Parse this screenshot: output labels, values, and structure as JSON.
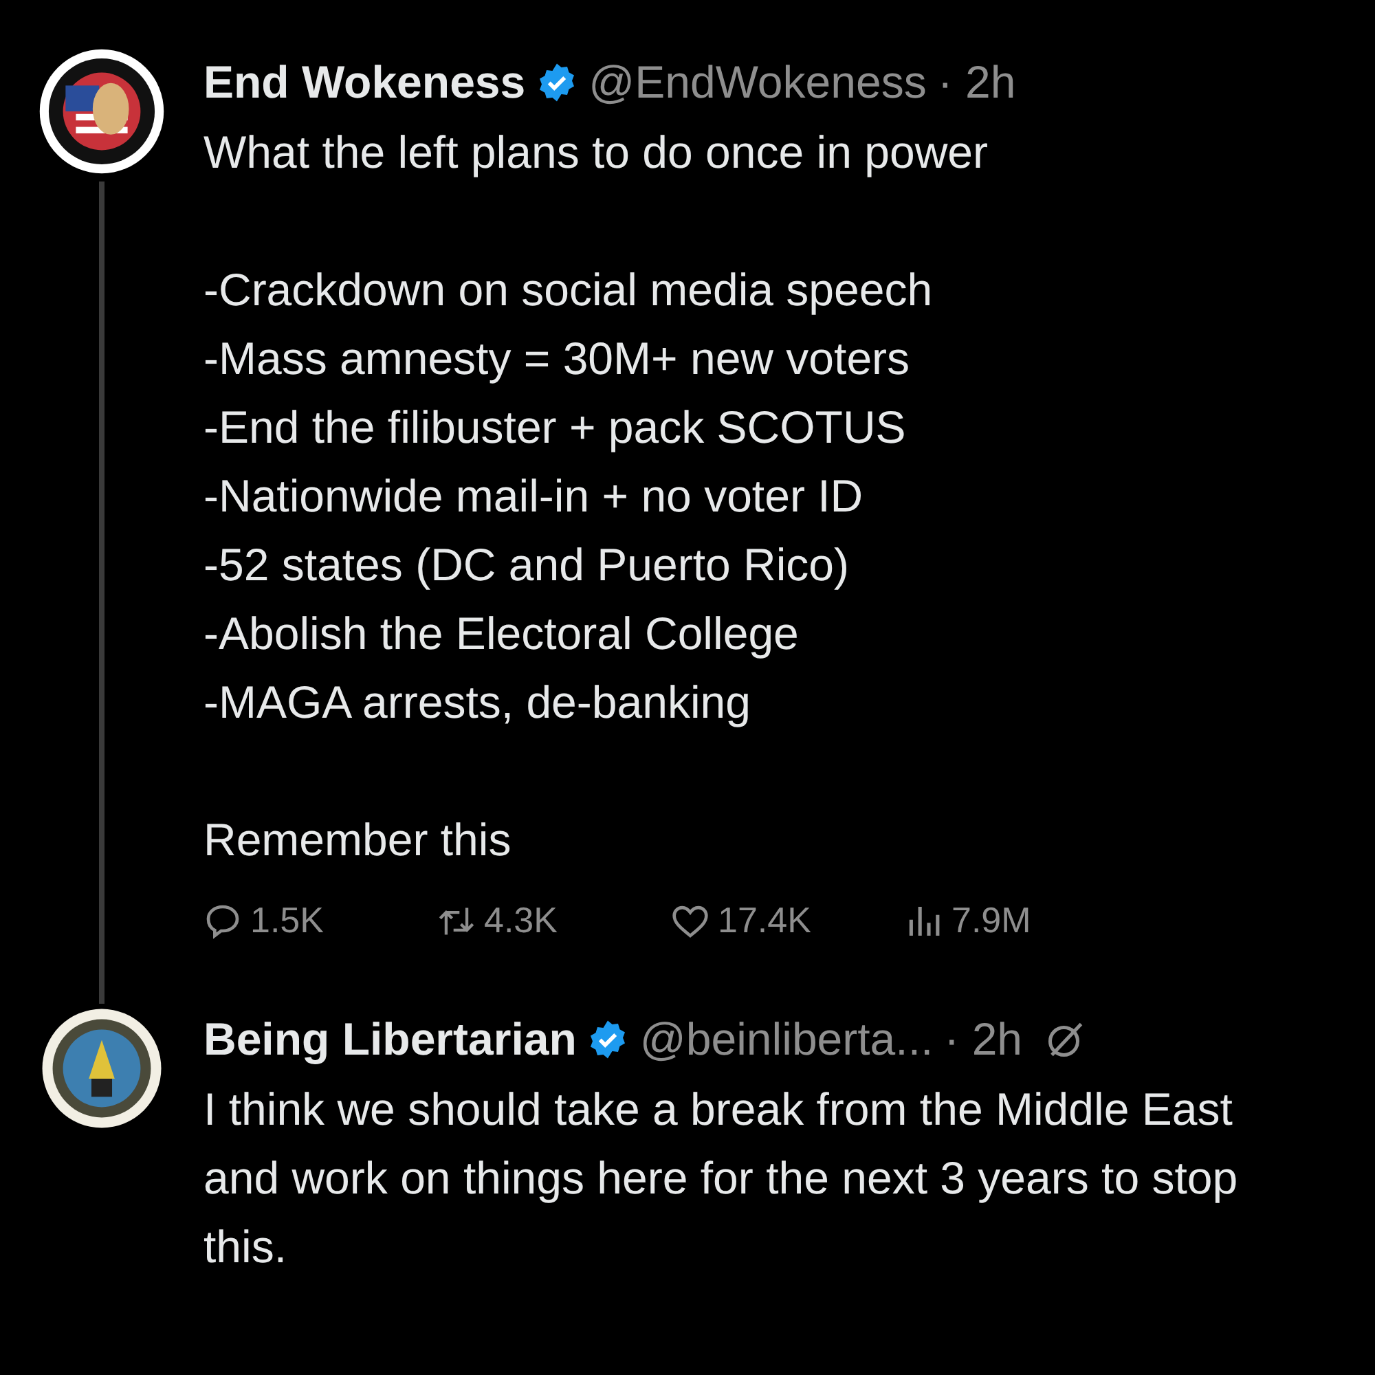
{
  "tweets": [
    {
      "name": "End Wokeness",
      "verified": true,
      "handle": "@EndWokeness",
      "time": "· 2h",
      "ai_icon": false,
      "thread_line": true,
      "paragraphs": [
        "What the left plans to do once in power",
        "-Crackdown on social media speech\n-Mass amnesty = 30M+ new voters\n-End the filibuster + pack SCOTUS\n-Nationwide mail-in + no voter ID\n-52 states (DC and Puerto Rico)\n-Abolish the Electoral College\n-MAGA arrests, de-banking",
        "Remember this"
      ],
      "metrics": [
        {
          "kind": "reply",
          "value": "1.5K"
        },
        {
          "kind": "repost",
          "value": "4.3K"
        },
        {
          "kind": "like",
          "value": "17.4K"
        },
        {
          "kind": "views",
          "value": "7.9M"
        }
      ]
    },
    {
      "name": "Being Libertarian",
      "verified": true,
      "handle": "@beinliberta...",
      "time": "· 2h",
      "ai_icon": true,
      "thread_line": false,
      "paragraphs": [
        "I think we should take a break from the Middle East and work on things here for the next 3 years to stop this."
      ]
    }
  ]
}
